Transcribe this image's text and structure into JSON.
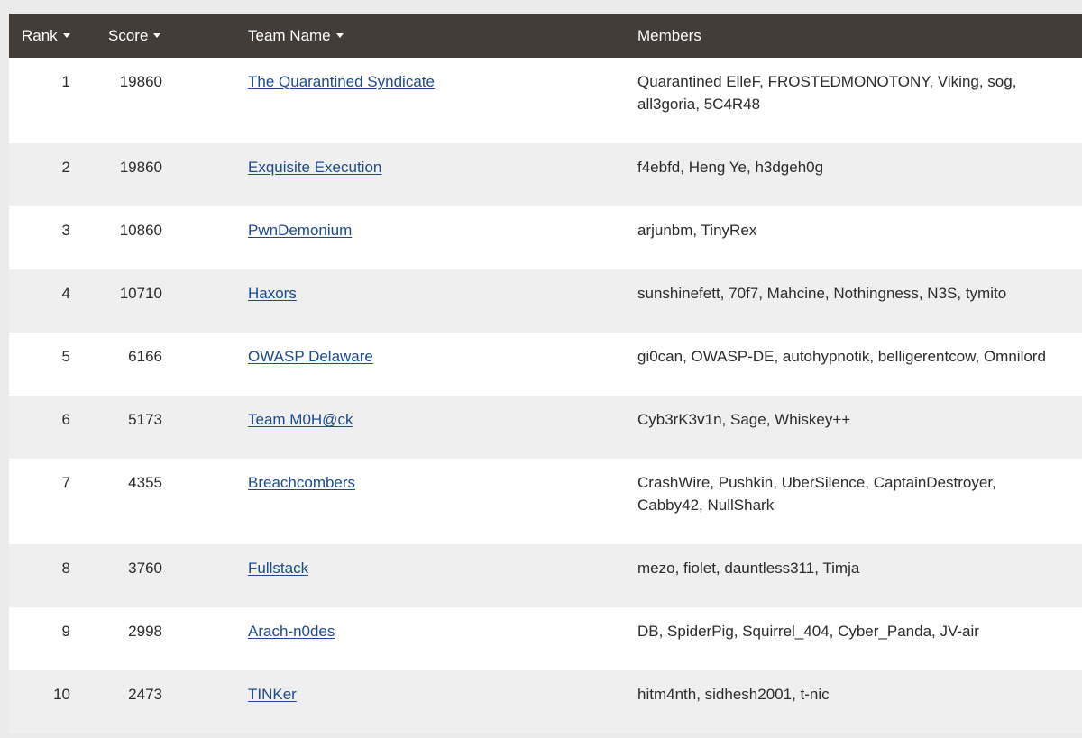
{
  "table": {
    "headers": {
      "rank": "Rank",
      "score": "Score",
      "team": "Team Name",
      "members": "Members"
    },
    "rows": [
      {
        "rank": "1",
        "score": "19860",
        "team": "The Quarantined Syndicate",
        "members_lines": [
          "Quarantined ElleF, FROSTEDMONOTONY, Viking, sog,",
          "all3goria, 5C4R48"
        ]
      },
      {
        "rank": "2",
        "score": "19860",
        "team": "Exquisite Execution",
        "members_lines": [
          "f4ebfd, Heng Ye, h3dgeh0g"
        ]
      },
      {
        "rank": "3",
        "score": "10860",
        "team": "PwnDemonium",
        "members_lines": [
          "arjunbm, TinyRex"
        ]
      },
      {
        "rank": "4",
        "score": "10710",
        "team": "Haxors",
        "members_lines": [
          "sunshinefett, 70f7, Mahcine, Nothingness, N3S, tymito"
        ]
      },
      {
        "rank": "5",
        "score": "6166",
        "team": "OWASP Delaware",
        "members_lines": [
          "gi0can, OWASP-DE, autohypnotik, belligerentcow, Omnilord"
        ]
      },
      {
        "rank": "6",
        "score": "5173",
        "team": "Team M0H@ck",
        "members_lines": [
          "Cyb3rK3v1n, Sage, Whiskey++"
        ]
      },
      {
        "rank": "7",
        "score": "4355",
        "team": "Breachcombers",
        "members_lines": [
          "CrashWire, Pushkin, UberSilence, CaptainDestroyer,",
          "Cabby42, NullShark"
        ]
      },
      {
        "rank": "8",
        "score": "3760",
        "team": "Fullstack",
        "members_lines": [
          "mezo, fiolet, dauntless311, Timja"
        ]
      },
      {
        "rank": "9",
        "score": "2998",
        "team": "Arach-n0des",
        "members_lines": [
          "DB, SpiderPig, Squirrel_404, Cyber_Panda, JV-air"
        ]
      },
      {
        "rank": "10",
        "score": "2473",
        "team": "TINKer",
        "members_lines": [
          "hitm4nth, sidhesh2001, t-nic"
        ]
      }
    ]
  }
}
